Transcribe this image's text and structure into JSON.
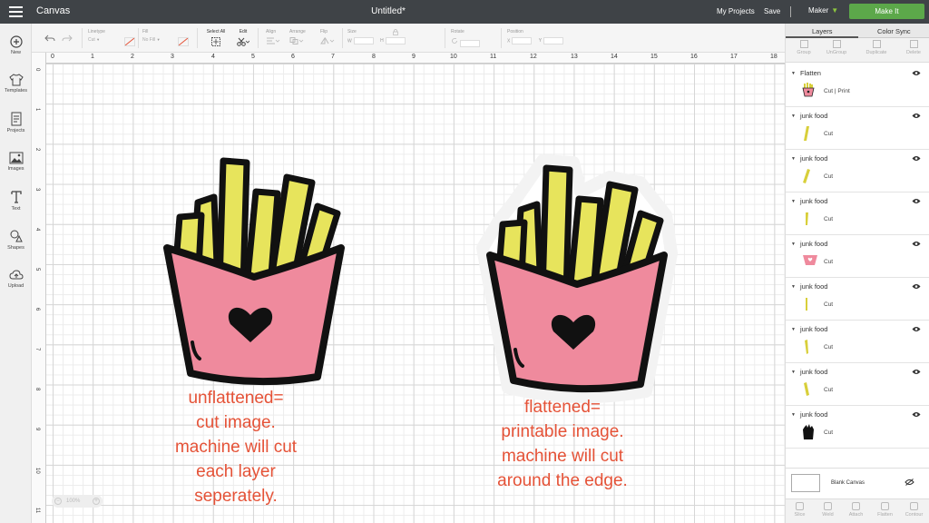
{
  "topbar": {
    "app_title": "Canvas",
    "doc_title": "Untitled*",
    "my_projects": "My Projects",
    "save": "Save",
    "machine": "Maker",
    "make_it": "Make It"
  },
  "sidebar": {
    "items": [
      {
        "label": "New",
        "icon": "plus-circle-icon"
      },
      {
        "label": "Templates",
        "icon": "tshirt-icon"
      },
      {
        "label": "Projects",
        "icon": "projects-icon"
      },
      {
        "label": "Images",
        "icon": "image-icon"
      },
      {
        "label": "Text",
        "icon": "text-icon"
      },
      {
        "label": "Shapes",
        "icon": "shapes-icon"
      },
      {
        "label": "Upload",
        "icon": "upload-icon"
      }
    ]
  },
  "toolbar": {
    "linetype_label": "Linetype",
    "linetype_value": "Cut",
    "fill_label": "Fill",
    "fill_value": "No Fill",
    "select_all": "Select All",
    "edit": "Edit",
    "align": "Align",
    "arrange": "Arrange",
    "flip": "Flip",
    "size": "Size",
    "size_w": "W",
    "size_h": "H",
    "rotate": "Rotate",
    "position": "Position",
    "pos_x": "X",
    "pos_y": "Y"
  },
  "canvas": {
    "ruler_top": [
      "0",
      "1",
      "2",
      "3",
      "4",
      "5",
      "6",
      "7",
      "8",
      "9",
      "10",
      "11",
      "12",
      "13",
      "14",
      "15",
      "16",
      "17",
      "18"
    ],
    "ruler_left": [
      "1",
      "2",
      "3",
      "4",
      "5",
      "6",
      "7",
      "8",
      "9",
      "10",
      "11"
    ],
    "caption_left": [
      "unflattened=",
      "cut image.",
      "machine will cut",
      "each layer",
      "seperately."
    ],
    "caption_right": [
      "flattened=",
      "printable image.",
      "machine will cut",
      "around the edge."
    ],
    "zoom_value": "100%"
  },
  "layers_panel": {
    "tab_layers": "Layers",
    "tab_color_sync": "Color Sync",
    "tools": [
      "Group",
      "UnGroup",
      "Duplicate",
      "Delete"
    ],
    "rows": [
      {
        "name": "Flatten",
        "type": "Cut  |  Print",
        "thumb": "fries"
      },
      {
        "name": "junk food",
        "type": "Cut",
        "thumb": "fry-1"
      },
      {
        "name": "junk food",
        "type": "Cut",
        "thumb": "fry-2"
      },
      {
        "name": "junk food",
        "type": "Cut",
        "thumb": "fry-3"
      },
      {
        "name": "junk food",
        "type": "Cut",
        "thumb": "box"
      },
      {
        "name": "junk food",
        "type": "Cut",
        "thumb": "fry-4"
      },
      {
        "name": "junk food",
        "type": "Cut",
        "thumb": "fry-5"
      },
      {
        "name": "junk food",
        "type": "Cut",
        "thumb": "fry-6"
      },
      {
        "name": "junk food",
        "type": "Cut",
        "thumb": "silhouette"
      }
    ],
    "blank_canvas": "Blank Canvas",
    "bottom_tools": [
      "Slice",
      "Weld",
      "Attach",
      "Flatten",
      "Contour"
    ]
  },
  "colors": {
    "topbar": "#3f4347",
    "accent_green": "#5ca84a",
    "fry_yellow": "#e7e45c",
    "box_pink": "#ef8a9d",
    "caption_red": "#e55237"
  }
}
